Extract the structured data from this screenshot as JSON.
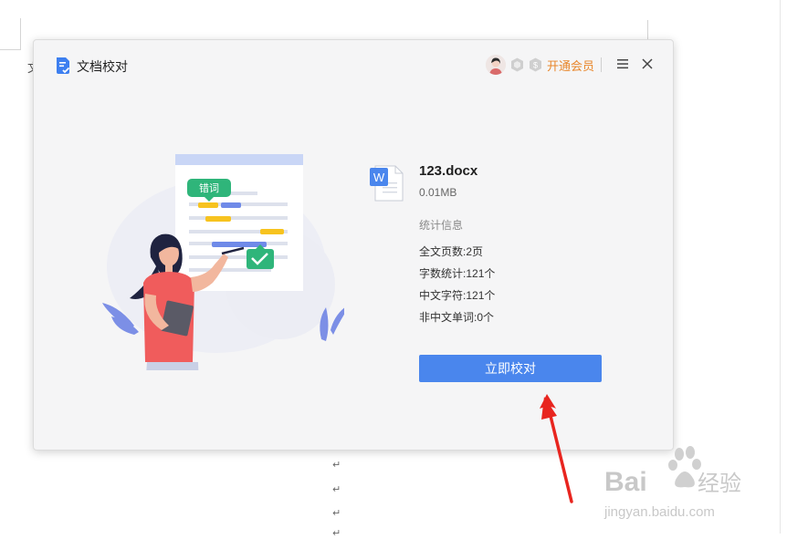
{
  "background": {
    "doc_char": "文",
    "para_mark": "↵"
  },
  "dialog": {
    "title": "文档校对",
    "vip_label": "开通会员"
  },
  "illustration": {
    "tag_label": "错词"
  },
  "file": {
    "icon_letter": "W",
    "name": "123.docx",
    "size": "0.01MB"
  },
  "stats": {
    "title": "统计信息",
    "items": [
      {
        "label": "全文页数:",
        "value": "2页"
      },
      {
        "label": "字数统计:",
        "value": "121个"
      },
      {
        "label": "中文字符:",
        "value": "121个"
      },
      {
        "label": "非中文单词:",
        "value": "0个"
      }
    ]
  },
  "action": {
    "label": "立即校对"
  },
  "watermark": {
    "brand": "Bai",
    "brand_cn": "经验",
    "url": "jingyan.baidu.com"
  },
  "colors": {
    "accent": "#4a86ed",
    "vip": "#e8862a",
    "arrow": "#e8251f",
    "tag": "#2fb57a"
  }
}
